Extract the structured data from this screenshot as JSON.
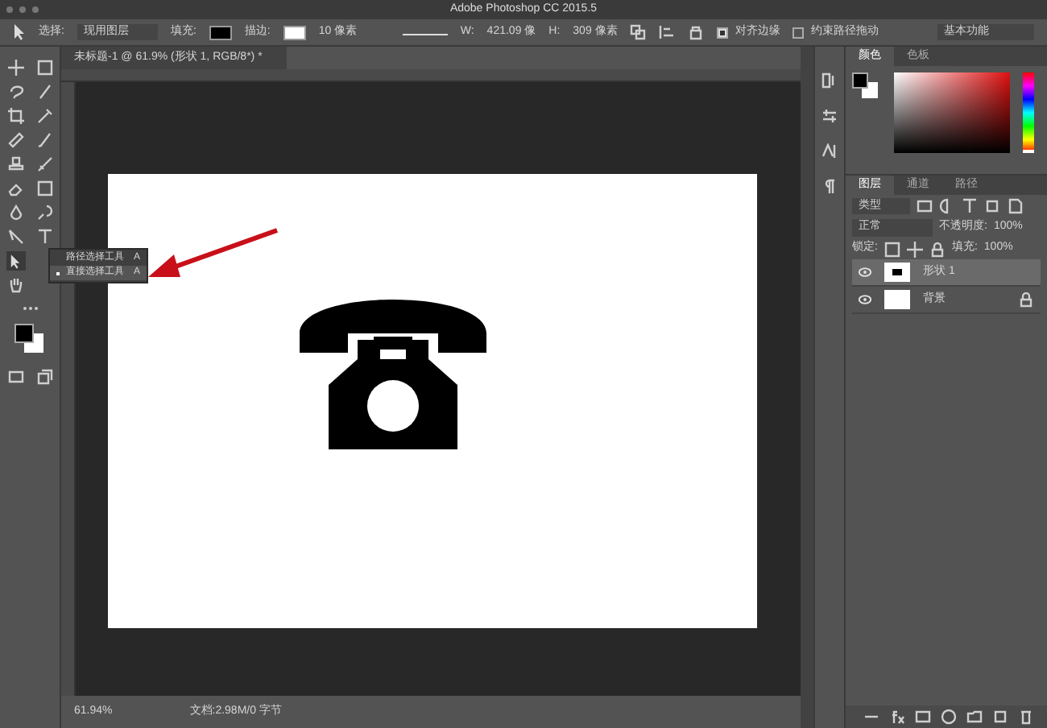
{
  "window": {
    "title": "Adobe Photoshop CC 2015.5"
  },
  "options_bar": {
    "select_label": "选择:",
    "select_value": "现用图层",
    "fill_label": "填充:",
    "stroke_label": "描边:",
    "stroke_width": "10 像素",
    "w_label": "W:",
    "w_value": "421.09 像",
    "h_label": "H:",
    "h_value": "309 像素",
    "checks": [
      {
        "label": "对齐边缘",
        "checked": true
      },
      {
        "label": "约束路径拖动",
        "checked": false
      }
    ],
    "workspace": "基本功能"
  },
  "document_tab": {
    "title": "未标题-1 @ 61.9% (形状 1, RGB/8*) *"
  },
  "tool_flyout": [
    {
      "label": "路径选择工具",
      "shortcut": "A",
      "selected": false
    },
    {
      "label": "直接选择工具",
      "shortcut": "A",
      "selected": true
    }
  ],
  "color_panel": {
    "hue_slider": {
      "level": 0.02
    },
    "tabs": [
      {
        "label": "颜色",
        "selected": true
      },
      {
        "label": "色板",
        "selected": false
      }
    ]
  },
  "layers_panel": {
    "tabs": [
      {
        "label": "图层",
        "selected": true
      },
      {
        "label": "通道",
        "selected": false
      },
      {
        "label": "路径",
        "selected": false
      }
    ],
    "filter": "类型",
    "blend_mode": "正常",
    "opacity_label": "不透明度:",
    "opacity": "100%",
    "lock_label": "锁定:",
    "fill_label": "填充:",
    "fill": "100%",
    "layers": [
      {
        "name": "形状 1",
        "kind": "shape",
        "selected": true
      },
      {
        "name": "背景",
        "kind": "background",
        "selected": false
      }
    ]
  },
  "status_bar": {
    "zoom": "61.94%",
    "doc_size": "文档:2.98M/0 字节"
  }
}
